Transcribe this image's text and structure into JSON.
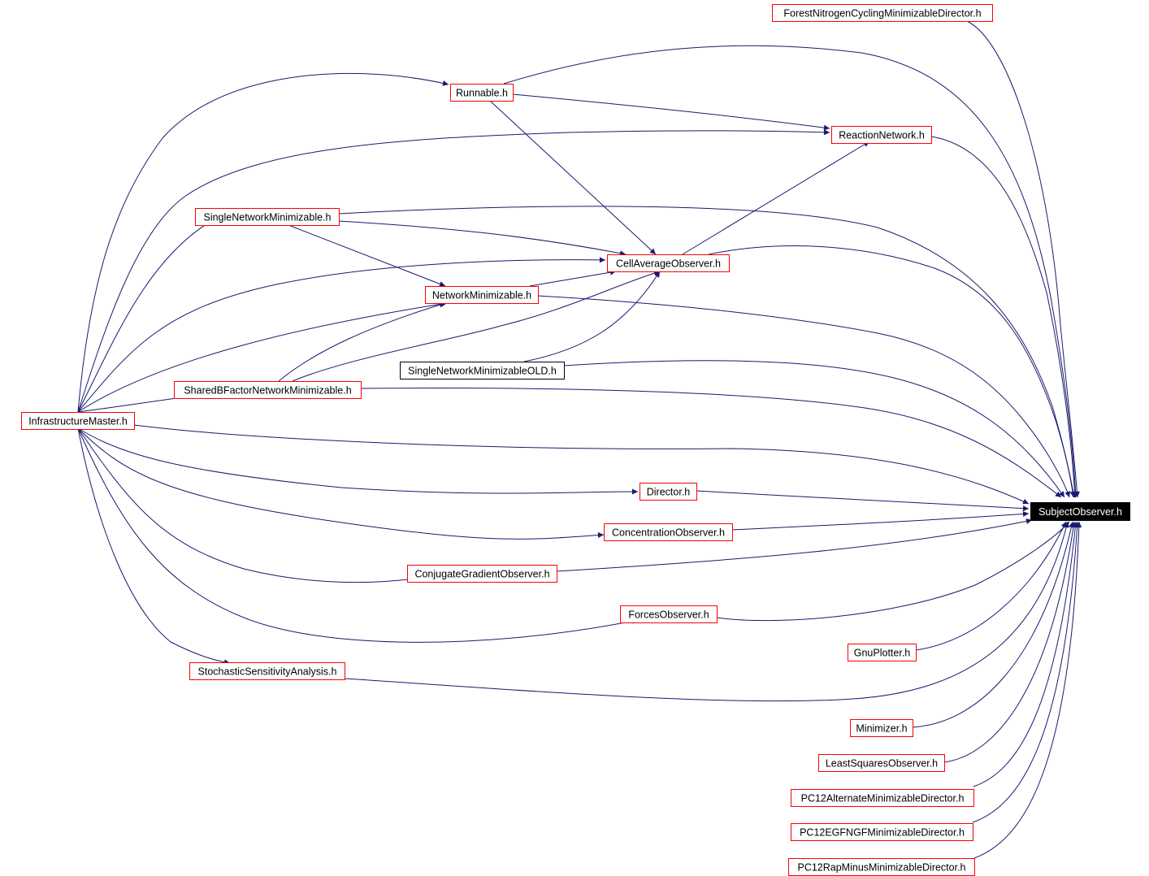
{
  "diagram": {
    "type": "include-dependency-graph",
    "colors": {
      "edge": "#191970",
      "node_border": "#ff0000",
      "node_border_nolink": "#000000",
      "node_fill": "#ffffff",
      "root_fill": "#000000",
      "root_text": "#ffffff",
      "text": "#000000"
    },
    "nodes": [
      {
        "id": "subject",
        "label": "SubjectObserver.h",
        "kind": "root"
      },
      {
        "id": "forest",
        "label": "ForestNitrogenCyclingMinimizableDirector.h",
        "kind": "link"
      },
      {
        "id": "runnable",
        "label": "Runnable.h",
        "kind": "link"
      },
      {
        "id": "reaction",
        "label": "ReactionNetwork.h",
        "kind": "link"
      },
      {
        "id": "single",
        "label": "SingleNetworkMinimizable.h",
        "kind": "link"
      },
      {
        "id": "cellavg",
        "label": "CellAverageObserver.h",
        "kind": "link"
      },
      {
        "id": "netmin",
        "label": "NetworkMinimizable.h",
        "kind": "link"
      },
      {
        "id": "singleold",
        "label": "SingleNetworkMinimizableOLD.h",
        "kind": "nolink"
      },
      {
        "id": "shared",
        "label": "SharedBFactorNetworkMinimizable.h",
        "kind": "link"
      },
      {
        "id": "infra",
        "label": "InfrastructureMaster.h",
        "kind": "link"
      },
      {
        "id": "director",
        "label": "Director.h",
        "kind": "link"
      },
      {
        "id": "conc",
        "label": "ConcentrationObserver.h",
        "kind": "link"
      },
      {
        "id": "conj",
        "label": "ConjugateGradientObserver.h",
        "kind": "link"
      },
      {
        "id": "forces",
        "label": "ForcesObserver.h",
        "kind": "link"
      },
      {
        "id": "gnu",
        "label": "GnuPlotter.h",
        "kind": "link"
      },
      {
        "id": "stoch",
        "label": "StochasticSensitivityAnalysis.h",
        "kind": "link"
      },
      {
        "id": "minimizer",
        "label": "Minimizer.h",
        "kind": "link"
      },
      {
        "id": "lsq",
        "label": "LeastSquaresObserver.h",
        "kind": "link"
      },
      {
        "id": "pc12alt",
        "label": "PC12AlternateMinimizableDirector.h",
        "kind": "link"
      },
      {
        "id": "pc12egf",
        "label": "PC12EGFNGFMinimizableDirector.h",
        "kind": "link"
      },
      {
        "id": "pc12rap",
        "label": "PC12RapMinusMinimizableDirector.h",
        "kind": "link"
      }
    ],
    "edges": [
      {
        "from": "forest",
        "to": "subject"
      },
      {
        "from": "runnable",
        "to": "subject"
      },
      {
        "from": "runnable",
        "to": "reaction"
      },
      {
        "from": "runnable",
        "to": "cellavg"
      },
      {
        "from": "reaction",
        "to": "subject"
      },
      {
        "from": "single",
        "to": "subject"
      },
      {
        "from": "single",
        "to": "cellavg"
      },
      {
        "from": "single",
        "to": "netmin"
      },
      {
        "from": "cellavg",
        "to": "subject"
      },
      {
        "from": "cellavg",
        "to": "reaction"
      },
      {
        "from": "netmin",
        "to": "subject"
      },
      {
        "from": "netmin",
        "to": "cellavg"
      },
      {
        "from": "singleold",
        "to": "subject"
      },
      {
        "from": "singleold",
        "to": "cellavg"
      },
      {
        "from": "shared",
        "to": "subject"
      },
      {
        "from": "shared",
        "to": "netmin"
      },
      {
        "from": "shared",
        "to": "cellavg"
      },
      {
        "from": "infra",
        "to": "runnable"
      },
      {
        "from": "infra",
        "to": "reaction"
      },
      {
        "from": "infra",
        "to": "single"
      },
      {
        "from": "infra",
        "to": "cellavg"
      },
      {
        "from": "infra",
        "to": "netmin"
      },
      {
        "from": "infra",
        "to": "shared"
      },
      {
        "from": "infra",
        "to": "subject"
      },
      {
        "from": "infra",
        "to": "director"
      },
      {
        "from": "infra",
        "to": "conc"
      },
      {
        "from": "infra",
        "to": "conj"
      },
      {
        "from": "infra",
        "to": "forces"
      },
      {
        "from": "infra",
        "to": "stoch"
      },
      {
        "from": "director",
        "to": "subject"
      },
      {
        "from": "conc",
        "to": "subject"
      },
      {
        "from": "conj",
        "to": "subject"
      },
      {
        "from": "forces",
        "to": "subject"
      },
      {
        "from": "gnu",
        "to": "subject"
      },
      {
        "from": "stoch",
        "to": "subject"
      },
      {
        "from": "minimizer",
        "to": "subject"
      },
      {
        "from": "lsq",
        "to": "subject"
      },
      {
        "from": "pc12alt",
        "to": "subject"
      },
      {
        "from": "pc12egf",
        "to": "subject"
      },
      {
        "from": "pc12rap",
        "to": "subject"
      }
    ]
  }
}
